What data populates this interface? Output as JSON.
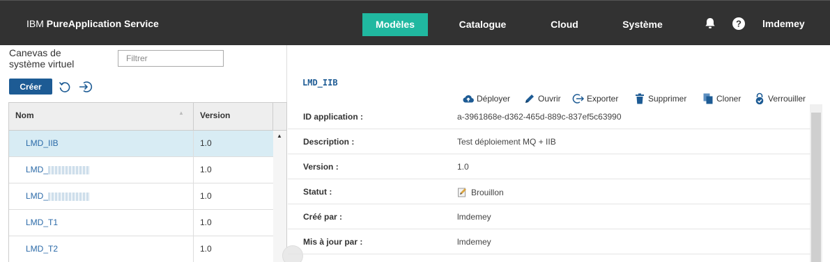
{
  "header": {
    "brand_prefix": "IBM ",
    "brand_name": "PureApplication Service",
    "nav": [
      {
        "label": "Modèles",
        "active": true
      },
      {
        "label": "Catalogue",
        "active": false
      },
      {
        "label": "Cloud",
        "active": false
      },
      {
        "label": "Système",
        "active": false
      }
    ],
    "icons": [
      "bell-icon",
      "help-icon"
    ],
    "user": "lmdemey",
    "accent_color": "#20b8a0"
  },
  "left": {
    "title": "Canevas de système virtuel",
    "filter_placeholder": "Filtrer",
    "create_label": "Créer",
    "icons": [
      "refresh-icon",
      "import-icon"
    ],
    "columns": {
      "name": "Nom",
      "version": "Version"
    },
    "rows": [
      {
        "name": "LMD_IIB",
        "version": "1.0",
        "selected": true
      },
      {
        "name": "LMD_",
        "version": "1.0",
        "selected": false,
        "redacted": true
      },
      {
        "name": "LMD_",
        "version": "1.0",
        "selected": false,
        "redacted": true
      },
      {
        "name": "LMD_T1",
        "version": "1.0",
        "selected": false
      },
      {
        "name": "LMD_T2",
        "version": "1.0",
        "selected": false
      }
    ]
  },
  "detail": {
    "title": "LMD_IIB",
    "actions": [
      {
        "label": "Déployer",
        "icon": "cloud-upload-icon"
      },
      {
        "label": "Ouvrir",
        "icon": "pencil-icon"
      },
      {
        "label": "Exporter",
        "icon": "export-icon"
      },
      {
        "label": "Supprimer",
        "icon": "trash-icon"
      },
      {
        "label": "Cloner",
        "icon": "clone-icon"
      },
      {
        "label": "Verrouiller",
        "icon": "lock-check-icon"
      }
    ],
    "properties": [
      {
        "label": "ID application :",
        "value": "a-3961868e-d362-465d-889c-837ef5c63990"
      },
      {
        "label": "Description :",
        "value": "Test déploiement MQ + IIB"
      },
      {
        "label": "Version :",
        "value": "1.0"
      },
      {
        "label": "Statut :",
        "value": "Brouillon",
        "icon": "draft-icon"
      },
      {
        "label": "Créé par :",
        "value": "lmdemey"
      },
      {
        "label": "Mis à jour par :",
        "value": "lmdemey"
      }
    ]
  }
}
